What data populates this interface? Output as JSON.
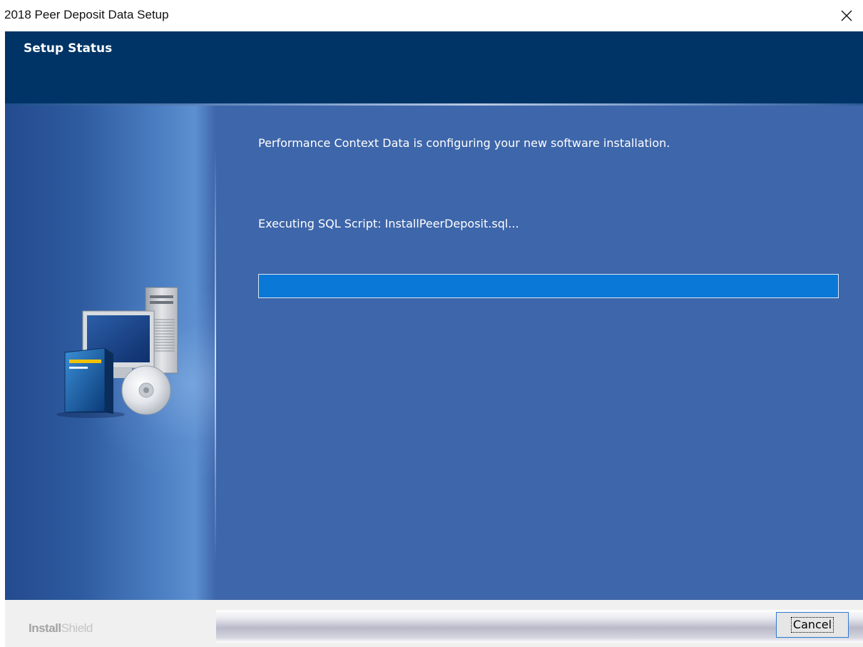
{
  "window": {
    "title": "2018 Peer Deposit Data Setup"
  },
  "header": {
    "title": "Setup Status"
  },
  "main": {
    "status_text": "Performance Context Data is configuring your new software installation.",
    "action_text": "Executing SQL Script: InstallPeerDeposit.sql...",
    "progress_fraction": 1.0
  },
  "footer": {
    "logo_strong": "Install",
    "logo_light": "Shield",
    "cancel_label": "Cancel"
  },
  "colors": {
    "header_bg": "#003466",
    "body_bg": "#3e66aa",
    "progress_fill": "#0a78d7"
  },
  "icons": {
    "close": "close-icon",
    "illustration": "computer-install-illustration"
  }
}
